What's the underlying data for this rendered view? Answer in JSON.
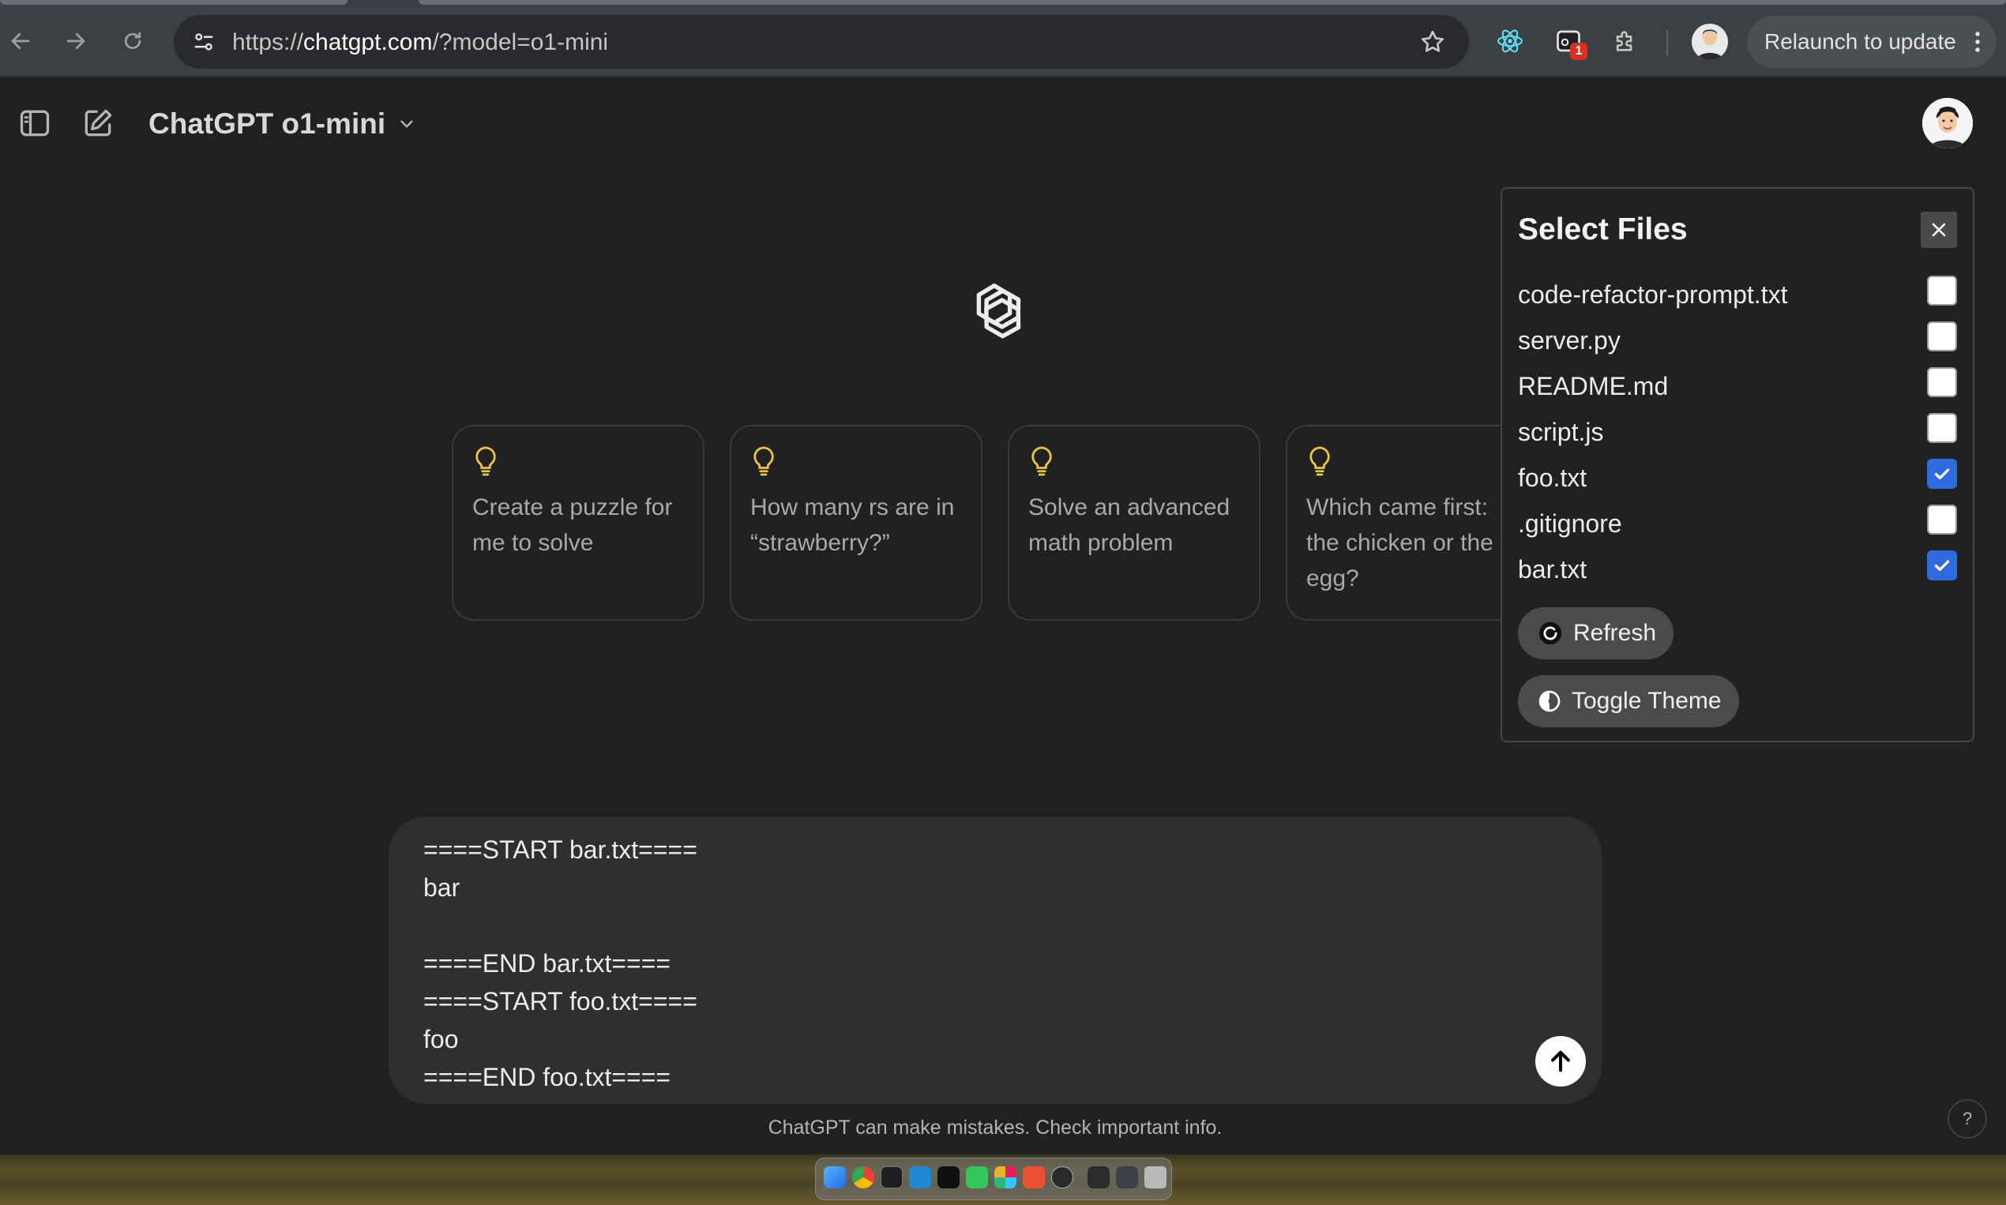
{
  "browser": {
    "url_scheme": "https://",
    "url_host": "chatgpt.com",
    "url_path": "/?model=o1-mini",
    "relaunch_label": "Relaunch to update",
    "extension_badge": "1"
  },
  "header": {
    "title": "ChatGPT o1-mini"
  },
  "suggestions": [
    {
      "text": "Create a puzzle for me to solve"
    },
    {
      "text": "How many rs are in “strawberry?”"
    },
    {
      "text": "Solve an advanced math problem"
    },
    {
      "text": "Which came first: the chicken or the egg?"
    }
  ],
  "composer": {
    "lines": [
      "====START bar.txt====",
      "bar",
      "",
      "====END bar.txt====",
      "====START foo.txt====",
      "foo",
      "====END foo.txt===="
    ]
  },
  "footer": {
    "note": "ChatGPT can make mistakes. Check important info.",
    "help": "?"
  },
  "files_panel": {
    "title": "Select Files",
    "files": [
      {
        "name": "code-refactor-prompt.txt",
        "checked": false
      },
      {
        "name": "server.py",
        "checked": false
      },
      {
        "name": "README.md",
        "checked": false
      },
      {
        "name": "script.js",
        "checked": false
      },
      {
        "name": "foo.txt",
        "checked": true
      },
      {
        "name": ".gitignore",
        "checked": false
      },
      {
        "name": "bar.txt",
        "checked": true
      }
    ],
    "refresh_label": "Refresh",
    "toggle_theme_label": "Toggle Theme"
  },
  "colors": {
    "background": "#212121",
    "composer": "#2f2f2f",
    "checkbox_checked": "#2f6bdc",
    "bulb": "#e8c547"
  }
}
